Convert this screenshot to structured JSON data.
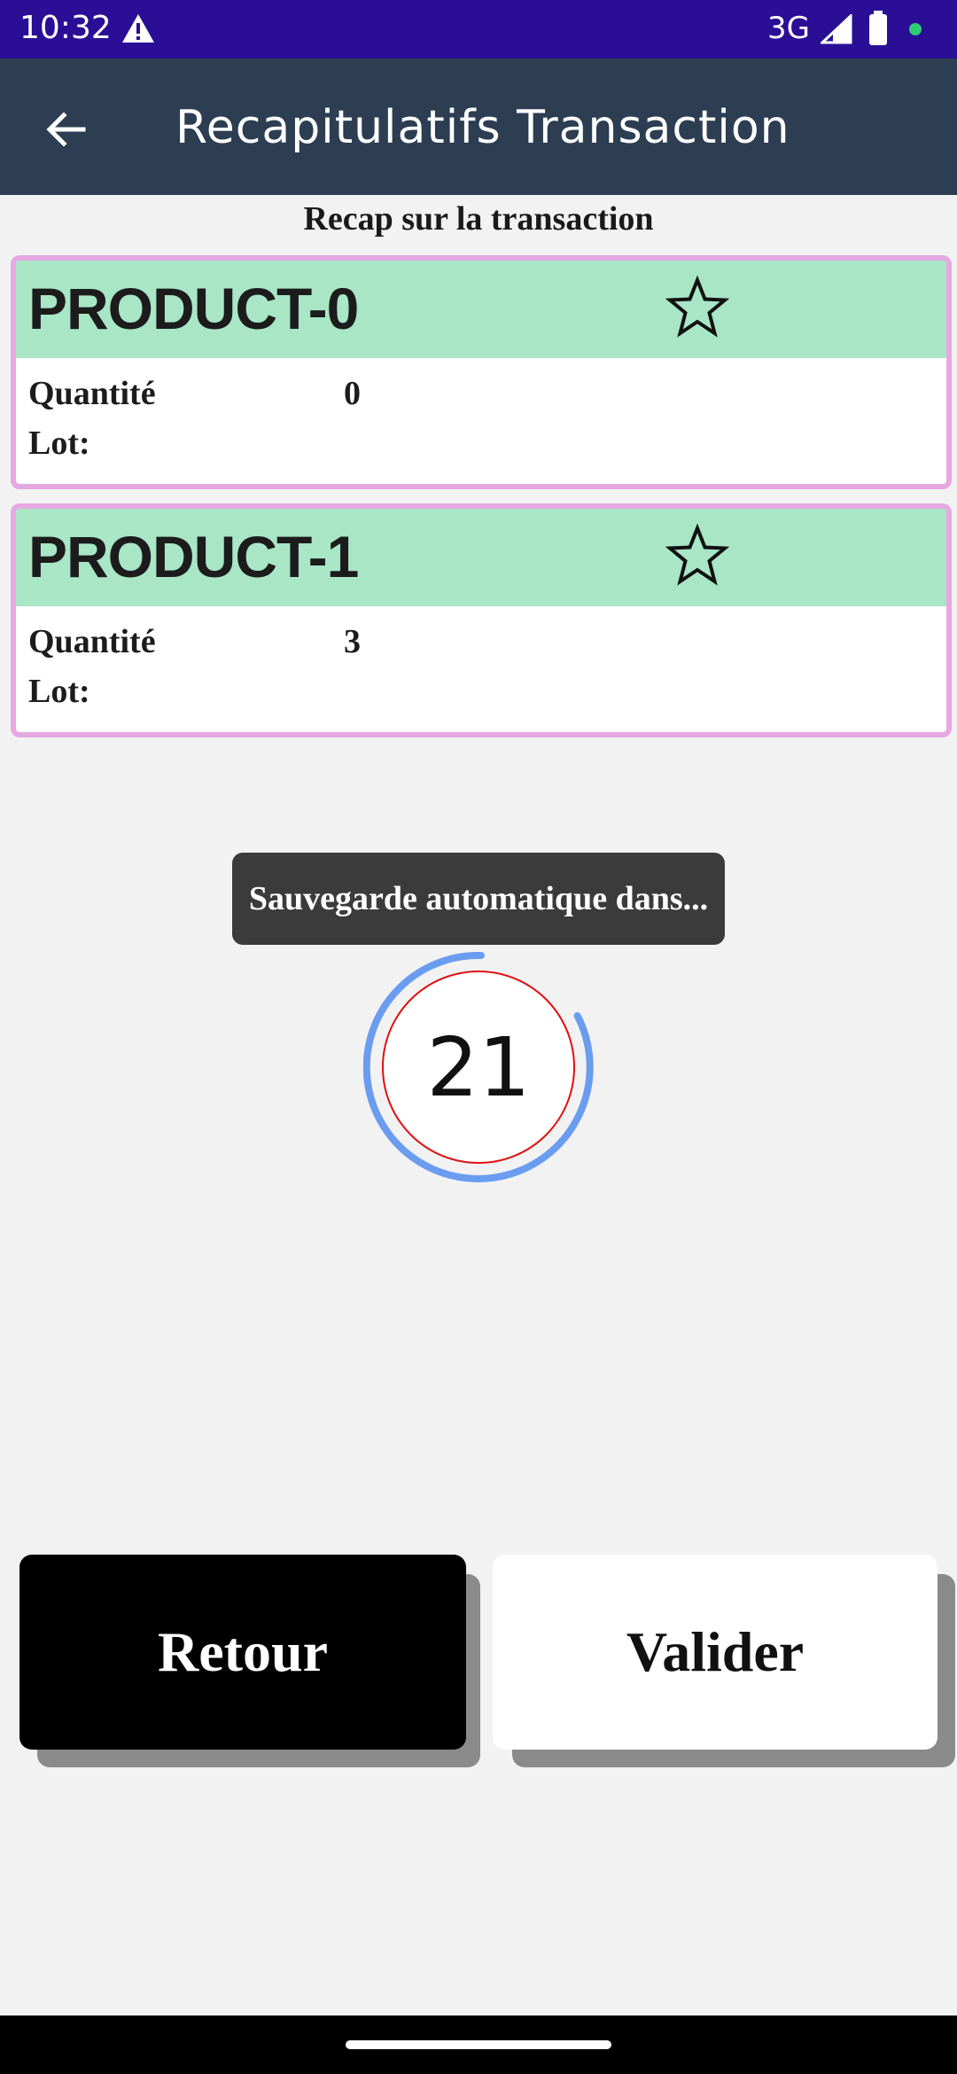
{
  "status_bar": {
    "time": "10:32",
    "network": "3G",
    "icons": [
      "warning-icon",
      "signal-icon",
      "battery-icon",
      "notification-dot-icon"
    ],
    "background_color": "#2a0e96"
  },
  "app_bar": {
    "title": "Recapitulatifs Transaction",
    "back_icon": "arrow-left-icon",
    "background_color": "#2d3d52"
  },
  "subtitle": "Recap sur la transaction",
  "products": [
    {
      "name": "PRODUCT-0",
      "favorite_icon": "star-outline-icon",
      "quantity_label": "Quantité",
      "quantity": "0",
      "lot_label": "Lot:"
    },
    {
      "name": "PRODUCT-1",
      "favorite_icon": "star-outline-icon",
      "quantity_label": "Quantité",
      "quantity": "3",
      "lot_label": "Lot:"
    }
  ],
  "toast": {
    "text": "Sauvegarde automatique dans..."
  },
  "countdown": {
    "value": "21",
    "ring_color": "#6a9cf0",
    "inner_circle_color": "#e01010"
  },
  "buttons": {
    "retour_label": "Retour",
    "valider_label": "Valider"
  },
  "colors": {
    "card_border": "#e6a8e2",
    "card_header": "#a8e6c6",
    "page_background": "#f2f2f2"
  }
}
